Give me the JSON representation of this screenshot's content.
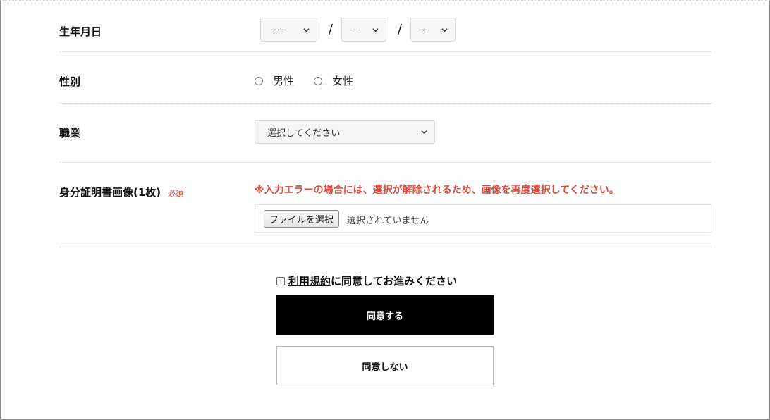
{
  "birthdate": {
    "label": "生年月日",
    "year_value": "----",
    "month_value": "--",
    "day_value": "--",
    "separator": "/"
  },
  "gender": {
    "label": "性別",
    "options": [
      "男性",
      "女性"
    ]
  },
  "occupation": {
    "label": "職業",
    "selected": "選択してください"
  },
  "id_image": {
    "label": "身分証明書画像(1枚)",
    "required_badge": "必須",
    "warning": "※入力エラーの場合には、選択が解除されるため、画像を再度選択してください。",
    "file_button": "ファイルを選択",
    "file_status": "選択されていません"
  },
  "terms": {
    "link_text": "利用規約",
    "suffix_text": "に同意してお進みください"
  },
  "buttons": {
    "agree": "同意する",
    "disagree": "同意しない"
  },
  "colors": {
    "warning": "#d94a3d",
    "primary_button": "#000000"
  }
}
